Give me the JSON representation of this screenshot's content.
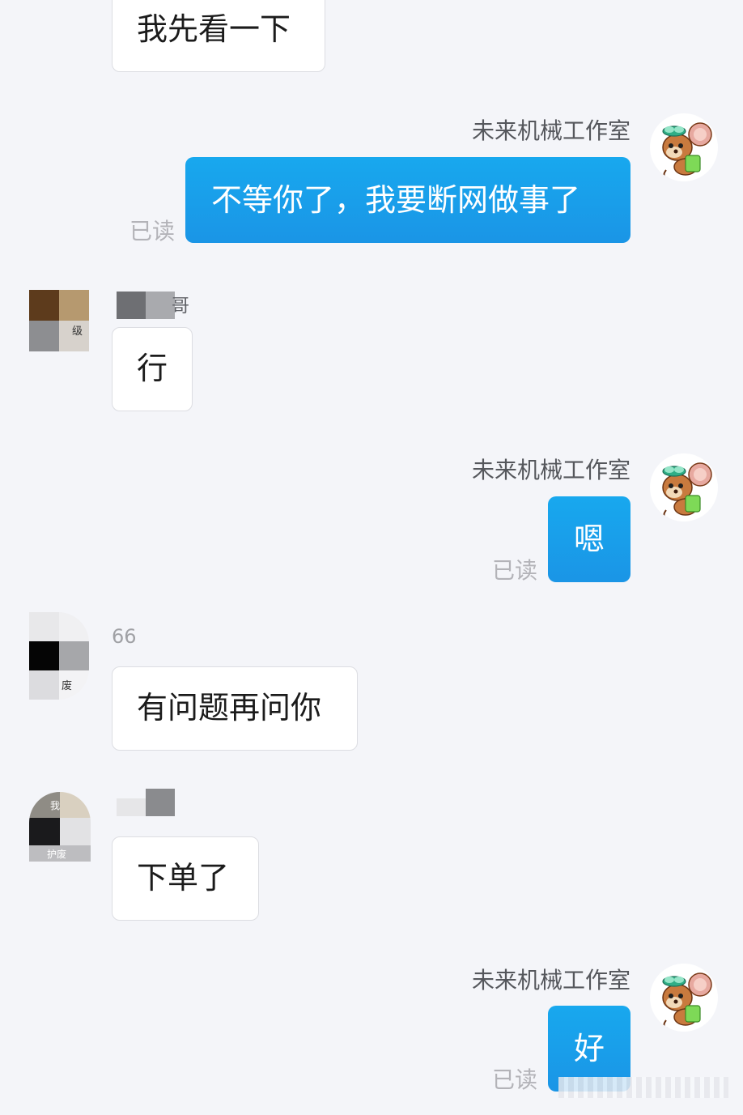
{
  "messages": [
    {
      "direction": "in",
      "text": "我先看一下"
    },
    {
      "direction": "out",
      "sender": "未来机械工作室",
      "text": "不等你了，我要断网做事了",
      "status": "已读"
    },
    {
      "direction": "in",
      "sender_partial": "哥",
      "text": "行"
    },
    {
      "direction": "out",
      "sender": "未来机械工作室",
      "text": "嗯",
      "status": "已读"
    },
    {
      "direction": "in",
      "sender_partial": "66",
      "text": "有问题再问你"
    },
    {
      "direction": "in",
      "sender_partial": "",
      "text": "下单了"
    },
    {
      "direction": "out",
      "sender": "未来机械工作室",
      "text": "好",
      "status": "已读"
    }
  ],
  "avatars": {
    "self": {
      "icon": "cartoon-mouse-avatar"
    },
    "contact_1": {
      "icon": "pixelated-avatar",
      "overlay_text": "级"
    },
    "contact_2": {
      "icon": "pixelated-avatar",
      "overlay_text": "废"
    },
    "contact_3": {
      "icon": "pixelated-avatar",
      "overlay_text": [
        "我",
        "护废"
      ]
    }
  },
  "colors": {
    "background": "#f4f5f9",
    "outgoing_bubble": "#1a9fea",
    "incoming_bubble": "#ffffff",
    "read_status": "#b3b3b8",
    "sender_name": "#55575c"
  }
}
